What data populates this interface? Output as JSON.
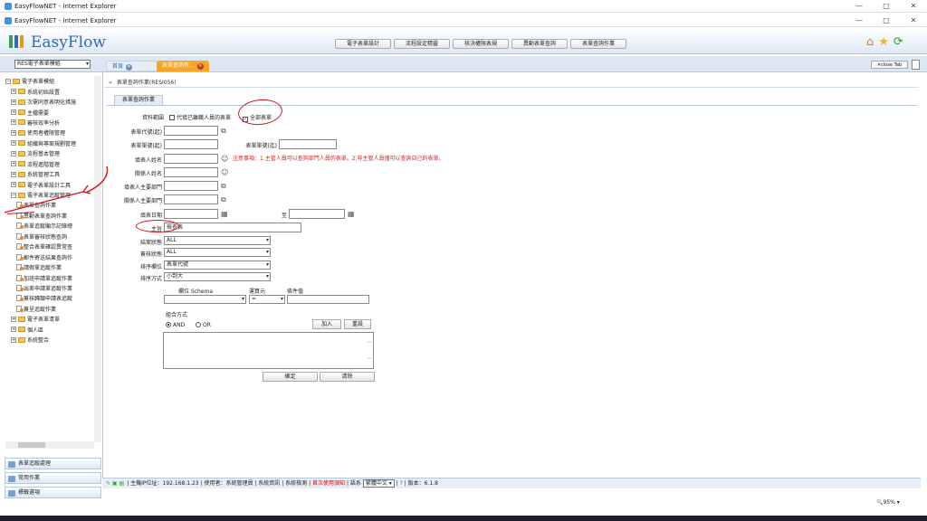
{
  "windows": [
    {
      "title": "EasyFlowNET - Internet Explorer"
    },
    {
      "title": "EasyFlowNET - Internet Explorer"
    }
  ],
  "window_controls": {
    "min": "—",
    "max": "□",
    "close": "✕"
  },
  "logo": "EasyFlow",
  "nav": [
    "電子表單設計",
    "流程設定精靈",
    "核決權限表規",
    "異動表單查詢",
    "表單查詢作業"
  ],
  "module_select": "RES電子表單模組",
  "tabs": {
    "home": "首頁",
    "active": "表單查詢作..."
  },
  "close_tab": "close Tab",
  "tree": [
    {
      "label": "電子表單模組",
      "lv": 0,
      "t": "ex"
    },
    {
      "label": "系統初始設置",
      "lv": 1,
      "t": "f"
    },
    {
      "label": "次需同意表明化措施",
      "lv": 1,
      "t": "f"
    },
    {
      "label": "主檔需要",
      "lv": 1,
      "t": "f"
    },
    {
      "label": "審核效率分析",
      "lv": 1,
      "t": "f"
    },
    {
      "label": "使用者權限管理",
      "lv": 1,
      "t": "f"
    },
    {
      "label": "組織與專案規劃管理",
      "lv": 1,
      "t": "f"
    },
    {
      "label": "流程基本管理",
      "lv": 1,
      "t": "f"
    },
    {
      "label": "流程進階管理",
      "lv": 1,
      "t": "f"
    },
    {
      "label": "系統管理工具",
      "lv": 1,
      "t": "f"
    },
    {
      "label": "電子表單設計工具",
      "lv": 1,
      "t": "f"
    },
    {
      "label": "電子表單追蹤管理",
      "lv": 1,
      "t": "fo"
    },
    {
      "label": "表單查詢作業",
      "lv": 2,
      "t": "p"
    },
    {
      "label": "異動表單查詢作業",
      "lv": 2,
      "t": "p"
    },
    {
      "label": "表單追蹤顯示記錄總",
      "lv": 2,
      "t": "p"
    },
    {
      "label": "表單審核狀態查詢",
      "lv": 2,
      "t": "p"
    },
    {
      "label": "整合表單確認異常查",
      "lv": 2,
      "t": "p"
    },
    {
      "label": "郵件寄送結果查詢作",
      "lv": 2,
      "t": "p"
    },
    {
      "label": "請假單追蹤作業",
      "lv": 2,
      "t": "p"
    },
    {
      "label": "加班申請單追蹤作業",
      "lv": 2,
      "t": "p"
    },
    {
      "label": "出差申請單追蹤作業",
      "lv": 2,
      "t": "p"
    },
    {
      "label": "簽核歸類申請表追蹤",
      "lv": 2,
      "t": "p"
    },
    {
      "label": "簽呈追蹤作業",
      "lv": 2,
      "t": "p"
    },
    {
      "label": "電子表單清單",
      "lv": 1,
      "t": "f"
    },
    {
      "label": "個人區",
      "lv": 1,
      "t": "f"
    },
    {
      "label": "系統整合",
      "lv": 1,
      "t": "f"
    }
  ],
  "accordion": [
    "表單追蹤處理",
    "常用作業",
    "標籤選項"
  ],
  "page_title": "表單查詢作業(RESI056)",
  "form_tab": "表單查詢作業",
  "form": {
    "scope_label": "資料範圍",
    "scope_opt1": "代填已離職人員的表單",
    "scope_opt2": "全部表單",
    "form_code_label": "表單代號(起)",
    "form_no_start_label": "表單單號(起)",
    "form_no_end_label": "表單單號(迄)",
    "filler_label": "填表人姓名",
    "related_label": "關係人姓名",
    "filler_dept_label": "填表人主要部門",
    "related_dept_label": "關係人主要部門",
    "date_label": "填表日期",
    "to_label": "至",
    "subject_label": "主旨",
    "subject_value": "檢查表",
    "close_status_label": "結案狀態",
    "close_status_value": "ALL",
    "review_status_label": "簽核狀態",
    "review_status_value": "ALL",
    "sort_field_label": "排序欄位",
    "sort_field_value": "表單代號",
    "sort_order_label": "排序方式",
    "sort_order_value": "小到大",
    "schema_label": "欄位 Schema",
    "operator_label": "運算元",
    "operator_value": "=",
    "cond_label": "條件值",
    "combine_label": "組合方式",
    "and_label": "AND",
    "or_label": "OR",
    "add_button": "加入",
    "reset_button": "重設",
    "confirm_button": "確定",
    "clear_button": "清除"
  },
  "note": "注意事項：1.主管人員可以查詢部門人員的表單。2.非主管人員僅可以查詢自己的表單。",
  "status": {
    "host": "主機IP位址：192.168.1.23",
    "user": "使用者：系統管理員",
    "sysinfo": "系統資訊",
    "syscheck": "系統檢測",
    "first_use": "首次使用須知",
    "lang_label": "語系",
    "lang_value": "繁體中文",
    "version": "版本：6.1.8"
  },
  "zoom": "95%"
}
